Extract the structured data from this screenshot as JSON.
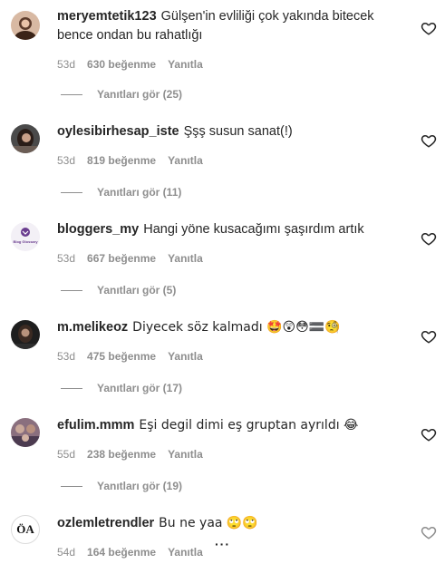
{
  "comments": [
    {
      "username": "meryemtetik123",
      "text": "Gülşen'in evliliği çok yakında bitecek bence ondan bu rahatlığı",
      "age": "53d",
      "likes": "630 beğenme",
      "reply": "Yanıtla",
      "view_replies": "Yanıtları gör (25)"
    },
    {
      "username": "oylesibirhesap_iste",
      "text": "Şşş susun sanat(!)",
      "age": "53d",
      "likes": "819 beğenme",
      "reply": "Yanıtla",
      "view_replies": "Yanıtları gör (11)"
    },
    {
      "username": "bloggers_my",
      "text": "Hangi yöne kusacağımı şaşırdım artık",
      "age": "53d",
      "likes": "667 beğenme",
      "reply": "Yanıtla",
      "view_replies": "Yanıtları gör (5)"
    },
    {
      "username": "m.melikeoz",
      "text": "Diyecek söz kalmadı 🤩😲😳🟰🧐",
      "age": "53d",
      "likes": "475 beğenme",
      "reply": "Yanıtla",
      "view_replies": "Yanıtları gör (17)"
    },
    {
      "username": "efulim.mmm",
      "text": "Eşi degil dimi eş gruptan ayrıldı 😂",
      "age": "55d",
      "likes": "238 beğenme",
      "reply": "Yanıtla",
      "view_replies": "Yanıtları gör (19)"
    },
    {
      "username": "ozlemletrendler",
      "text": "Bu ne yaa 🙄🙄",
      "age": "54d",
      "likes": "164 beğenme",
      "reply": "Yanıtla",
      "more": "···"
    }
  ],
  "avatar3_text": "Blog Glossary",
  "avatar6_text": "ÖA",
  "icons": {
    "like": "heart-icon",
    "options": "more-options-icon"
  }
}
